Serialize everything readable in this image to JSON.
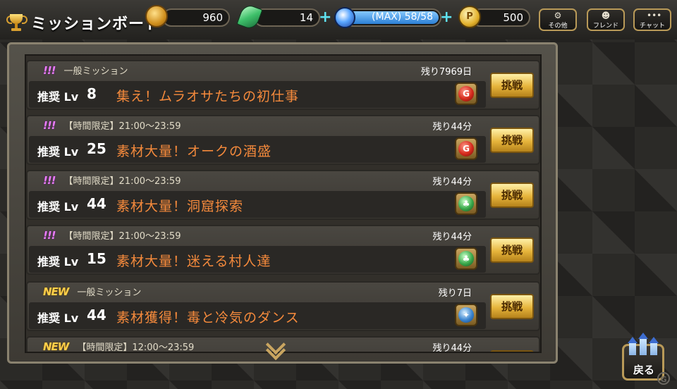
{
  "header": {
    "title": "ミッションボード",
    "title_icon": "trophy-icon",
    "resources": {
      "coins": "960",
      "leaves": "14",
      "stamina": {
        "label": "(MAX) 58/58",
        "current": 58,
        "max": 58
      },
      "points": "500"
    },
    "buttons": {
      "other": "その他",
      "friend": "フレンド",
      "chat": "チャット"
    }
  },
  "missions": [
    {
      "badge": "!!!",
      "badge_color": "#e87cf5",
      "category": "一般ミッション",
      "remaining": "残り7969日",
      "level_label": "推奨 Lv",
      "level": "8",
      "name": "集え！ムラオサたちの初仕事",
      "element": "fire",
      "button": "挑戦"
    },
    {
      "badge": "!!!",
      "badge_color": "#e87cf5",
      "category": "【時間限定】21:00〜23:59",
      "remaining": "残り44分",
      "level_label": "推奨 Lv",
      "level": "25",
      "name": "素材大量！オークの酒盛",
      "element": "fire",
      "button": "挑戦"
    },
    {
      "badge": "!!!",
      "badge_color": "#e87cf5",
      "category": "【時間限定】21:00〜23:59",
      "remaining": "残り44分",
      "level_label": "推奨 Lv",
      "level": "44",
      "name": "素材大量！洞窟探索",
      "element": "wind",
      "button": "挑戦"
    },
    {
      "badge": "!!!",
      "badge_color": "#e87cf5",
      "category": "【時間限定】21:00〜23:59",
      "remaining": "残り44分",
      "level_label": "推奨 Lv",
      "level": "15",
      "name": "素材大量！迷える村人達",
      "element": "wind",
      "button": "挑戦"
    },
    {
      "badge": "NEW",
      "badge_color": "#ffcf4a",
      "category": "一般ミッション",
      "remaining": "残り7日",
      "level_label": "推奨 Lv",
      "level": "44",
      "name": "素材獲得！毒と冷気のダンス",
      "element": "water",
      "button": "挑戦"
    },
    {
      "badge": "NEW",
      "badge_color": "#ffcf4a",
      "category": "【時間限定】12:00〜23:59",
      "remaining": "残り44分",
      "level_label": "",
      "level": "",
      "name": "",
      "element": "",
      "button": ""
    }
  ],
  "back_button": {
    "label": "戻る",
    "icon": "castle-icon"
  },
  "colors": {
    "mission_name": "#f58a3c",
    "button_gold": "#e6b43b",
    "panel_border": "#8a826f"
  }
}
